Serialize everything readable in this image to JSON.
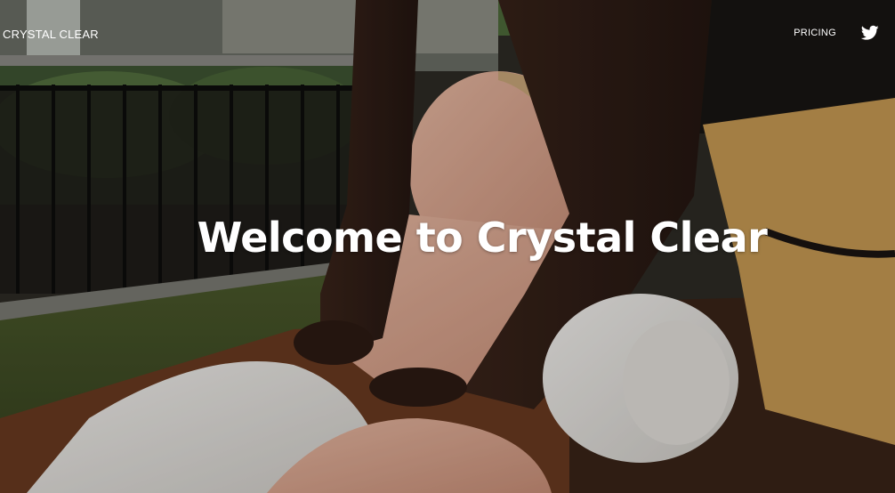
{
  "nav": {
    "brand": "CRYSTAL CLEAR",
    "links": [
      {
        "label": "PRICING"
      }
    ],
    "social_icon": "twitter-icon"
  },
  "hero": {
    "heading": "Welcome to Crystal Clear",
    "image": "massage-photo"
  },
  "colors": {
    "text": "#ffffff"
  }
}
